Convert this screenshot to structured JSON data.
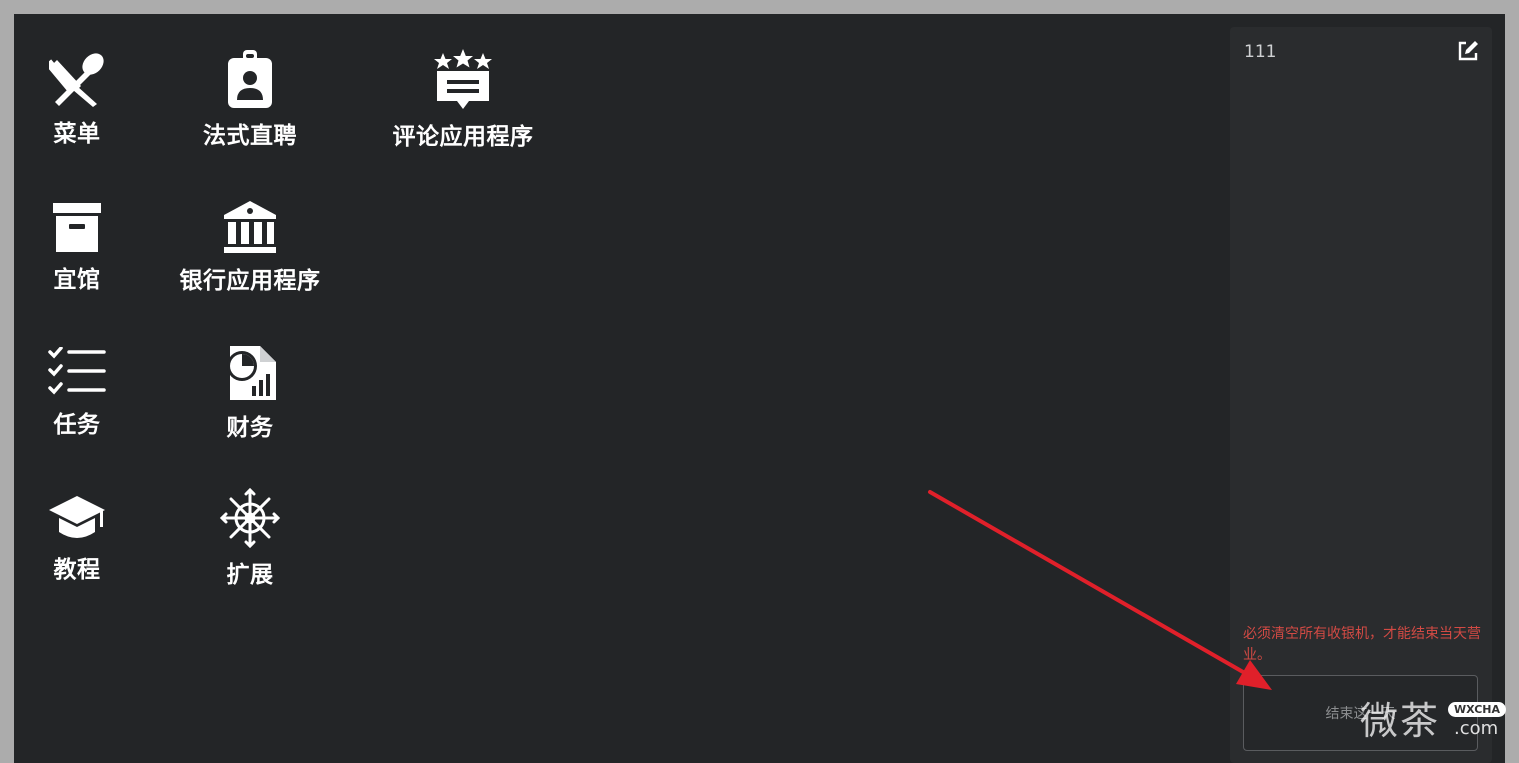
{
  "apps": [
    {
      "id": "menu",
      "label": "菜单",
      "icon": "utensils-icon"
    },
    {
      "id": "recruit",
      "label": "法式直聘",
      "icon": "id-badge-icon"
    },
    {
      "id": "review",
      "label": "评论应用程序",
      "icon": "star-review-icon"
    },
    {
      "id": "storage",
      "label": "宜馆",
      "icon": "archive-box-icon"
    },
    {
      "id": "bank",
      "label": "银行应用程序",
      "icon": "bank-icon"
    },
    {
      "id": "tasks",
      "label": "任务",
      "icon": "checklist-icon"
    },
    {
      "id": "finance",
      "label": "财务",
      "icon": "finance-report-icon"
    },
    {
      "id": "tutorial",
      "label": "教程",
      "icon": "graduation-cap-icon"
    },
    {
      "id": "extension",
      "label": "扩展",
      "icon": "ship-wheel-icon"
    }
  ],
  "register_panel": {
    "register_name": "111",
    "edit_icon": "edit-icon",
    "warning_text": "必须清空所有收银机，才能结束当天营业。",
    "close_day_button": "结束这一天"
  },
  "watermark": {
    "text": "微茶",
    "badge": "WXCHA",
    "domain": ".com"
  },
  "colors": {
    "background": "#232527",
    "panel": "#2a2c2e",
    "warning": "#d24a44",
    "arrow": "#e0202a"
  }
}
